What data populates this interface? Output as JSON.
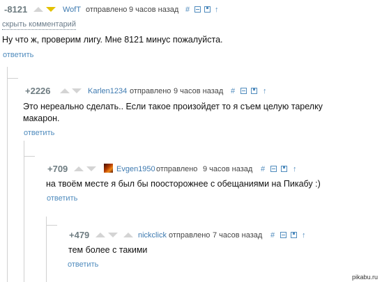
{
  "comments": [
    {
      "rating": "-8121",
      "user": "WofT",
      "sent": "отправлено",
      "time": "9 часов назад",
      "hide": "скрыть комментарий",
      "text": "Ну что ж, проверим лигу. Мне 8121 минус пожалуйста.",
      "reply": "ответить"
    },
    {
      "rating": "+2226",
      "user": "Karlen1234",
      "sent": "отправлено",
      "time": "9 часов назад",
      "text_line1": "Это нереально сделать.. Если такое произойдет то я съем целую тарелку",
      "text_line2": "макарон.",
      "reply": "ответить"
    },
    {
      "rating": "+709",
      "user": "Evgen1950",
      "sent": "отправлено",
      "time": "9 часов назад",
      "text": "на твоём месте я был бы поосторожнее с обещаниями на Пикабу :)",
      "reply": "ответить"
    },
    {
      "rating": "+479",
      "user": "nickclick",
      "sent": "отправлено",
      "time": "7 часов назад",
      "text": "тем более с такими",
      "reply": "ответить"
    }
  ],
  "icons": {
    "hash": "#",
    "arrow": "↑"
  },
  "watermark": "pikabu.ru"
}
